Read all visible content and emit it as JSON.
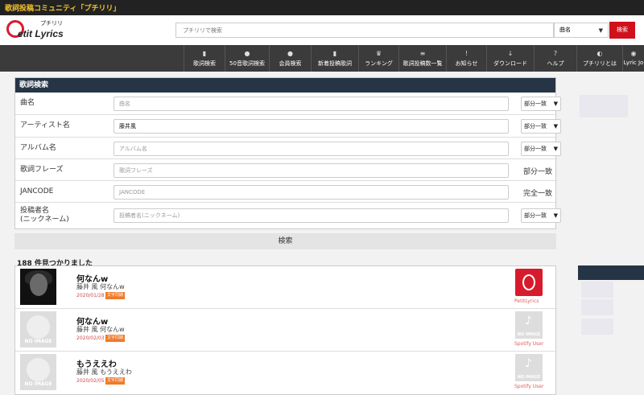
{
  "top_bar": {
    "title": "歌詞投稿コミュニティ「プチリリ」"
  },
  "logo": {
    "text": "etit Lyrics",
    "kana": "プチリリ"
  },
  "search": {
    "placeholder": "プチリリで検索",
    "select_value": "曲名",
    "button": "検索"
  },
  "nav": [
    {
      "label": "歌詞検索",
      "icon": "lyrics-search-icon"
    },
    {
      "label": "50音歌詞検索",
      "icon": "kana-search-icon"
    },
    {
      "label": "会員検索",
      "icon": "member-search-icon"
    },
    {
      "label": "新着投稿歌詞",
      "icon": "new-posts-icon"
    },
    {
      "label": "ランキング",
      "icon": "crown-icon"
    },
    {
      "label": "歌詞投稿数一覧",
      "icon": "list-icon"
    },
    {
      "label": "お知らせ",
      "icon": "info-icon"
    },
    {
      "label": "ダウンロード",
      "icon": "download-icon"
    },
    {
      "label": "ヘルプ",
      "icon": "help-icon"
    },
    {
      "label": "プチリリとは",
      "icon": "about-icon"
    },
    {
      "label": "Lyric Jo",
      "icon": "lyric-jockey-icon"
    }
  ],
  "search_panel": {
    "title": "歌詞検索",
    "rows": [
      {
        "label": "曲名",
        "placeholder": "曲名",
        "value": "",
        "match": "部分一致"
      },
      {
        "label": "アーティスト名",
        "placeholder": "アーティスト名",
        "value": "藤井風",
        "match": "部分一致"
      },
      {
        "label": "アルバム名",
        "placeholder": "アルバム名",
        "value": "",
        "match": "部分一致"
      },
      {
        "label": "歌詞フレーズ",
        "placeholder": "歌詞フレーズ",
        "value": "",
        "match": "部分一致"
      },
      {
        "label": "JANCODE",
        "placeholder": "JANCODE",
        "value": "",
        "match": "完全一致"
      },
      {
        "label": "投稿者名\n(ニックネーム)",
        "placeholder": "投稿者名(ニックネーム)",
        "value": "",
        "match": "部分一致"
      }
    ],
    "submit": "検索"
  },
  "result_count": "188 件見つかりました",
  "results": [
    {
      "title": "何なんw",
      "subtitle": "藤井 風 何なんw",
      "date": "2020/01/28",
      "badge": "文字同期",
      "source": "PetitLyrics",
      "thumb": "photo"
    },
    {
      "title": "何なんw",
      "subtitle": "藤井 風 何なんw",
      "date": "2020/02/03",
      "badge": "文字同期",
      "source": "Spotify User",
      "thumb": "NO IMAGE"
    },
    {
      "title": "もうええわ",
      "subtitle": "藤井 風 もうええわ",
      "date": "2020/02/05",
      "badge": "文字同期",
      "source": "Spotify User",
      "thumb": "NO IMAGE"
    }
  ]
}
